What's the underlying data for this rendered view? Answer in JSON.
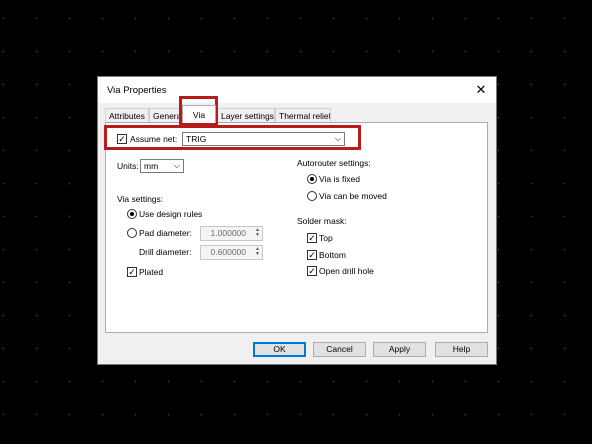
{
  "dialog": {
    "title": "Via Properties",
    "close": "✕",
    "tabs": [
      "Attributes",
      "Genera",
      "Via",
      "Layer settings",
      "Thermal relief"
    ],
    "active_tab": "Via"
  },
  "assume_net": {
    "label": "Assume net:",
    "checked": true,
    "value": "TRIG"
  },
  "units": {
    "label": "Units:",
    "value": "mm"
  },
  "via_settings": {
    "label": "Via settings:",
    "use_design_rules": "Use design rules",
    "pad_diameter_label": "Pad diameter:",
    "pad_diameter": "1.000000",
    "drill_diameter_label": "Drill diameter:",
    "drill_diameter": "0.600000",
    "plated": "Plated"
  },
  "autorouter": {
    "label": "Autorouter settings:",
    "via_is_fixed": "Via is fixed",
    "via_can_be_moved": "Via can be moved"
  },
  "solder_mask": {
    "label": "Solder mask:",
    "top": "Top",
    "bottom": "Bottom",
    "open_drill_hole": "Open drill hole"
  },
  "buttons": {
    "ok": "OK",
    "cancel": "Cancel",
    "apply": "Apply",
    "help": "Help"
  },
  "colors": {
    "highlight": "#b71c1c",
    "default_button_border": "#0078d7"
  }
}
